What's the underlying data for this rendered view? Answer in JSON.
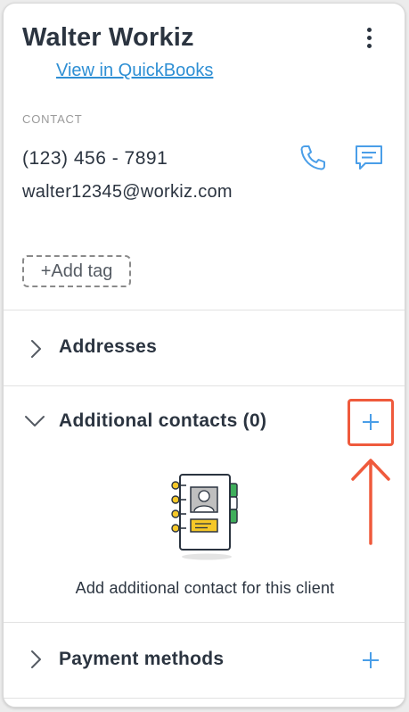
{
  "client": {
    "name": "Walter Workiz",
    "quickbooks_link": "View in QuickBooks"
  },
  "contact": {
    "section_label": "CONTACT",
    "phone": "(123) 456 - 7891",
    "email": "walter12345@workiz.com"
  },
  "tags": {
    "add_label": "+Add tag"
  },
  "sections": {
    "addresses": {
      "title": "Addresses",
      "expanded": false
    },
    "additional_contacts": {
      "title": "Additional contacts (0)",
      "expanded": true,
      "add_symbol": "+",
      "empty_message": "Add additional contact for this client"
    },
    "payment_methods": {
      "title": "Payment methods",
      "expanded": false,
      "add_symbol": "+"
    }
  },
  "icons": {
    "menu": "kebab-menu-icon",
    "call": "phone-icon",
    "message": "chat-icon",
    "collapsed": "chevron-right-icon",
    "expanded": "chevron-down-icon",
    "empty_state": "address-book-icon",
    "annotation": "arrow-up-icon"
  },
  "colors": {
    "text": "#2b3440",
    "link": "#2e8fd4",
    "accent_blue": "#4a9ee8",
    "annotation": "#ef5a3c"
  }
}
